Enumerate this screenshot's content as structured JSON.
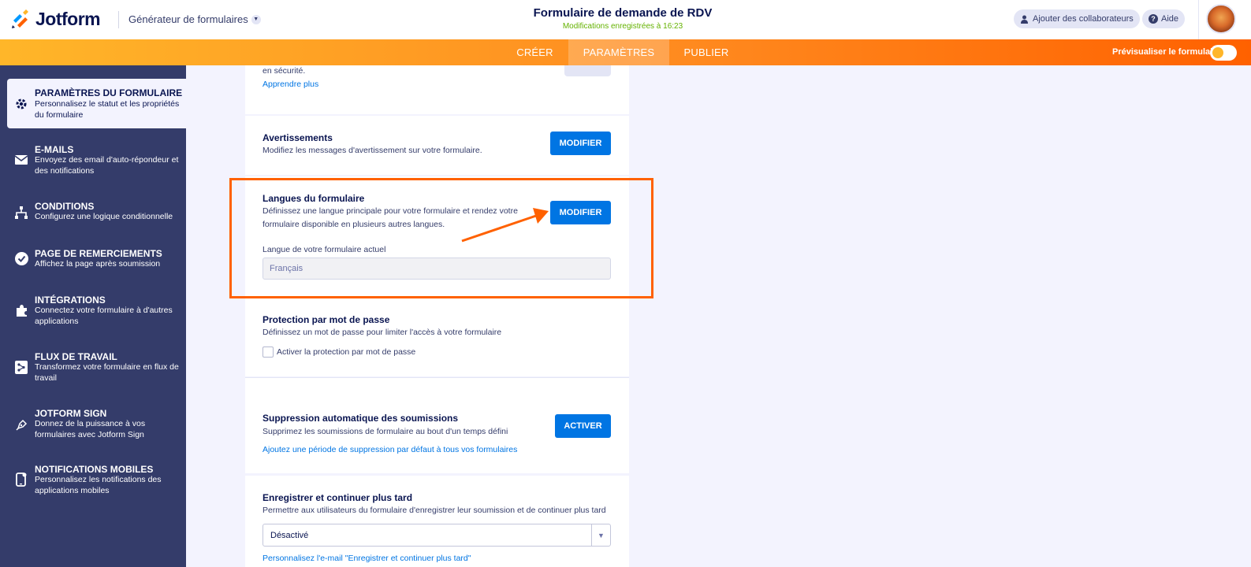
{
  "header": {
    "logo_text": "Jotform",
    "builder_label": "Générateur de formulaires",
    "form_title": "Formulaire de demande de RDV",
    "saved_status": "Modifications enregistrées à 16:23",
    "collab_label": "Ajouter des collaborateurs",
    "help_label": "Aide"
  },
  "nav": {
    "tabs": [
      {
        "label": "CRÉER",
        "active": false
      },
      {
        "label": "PARAMÈTRES",
        "active": true
      },
      {
        "label": "PUBLIER",
        "active": false
      }
    ],
    "preview_label": "Prévisualiser le formulaire"
  },
  "sidebar": {
    "items": [
      {
        "title": "PARAMÈTRES DU FORMULAIRE",
        "desc": "Personnalisez le statut et les propriétés du formulaire",
        "icon": "gear-icon",
        "active": true
      },
      {
        "title": "E-MAILS",
        "desc": "Envoyez des email d'auto-répondeur et des notifications",
        "icon": "envelope-icon"
      },
      {
        "title": "CONDITIONS",
        "desc": "Configurez une logique conditionnelle",
        "icon": "hierarchy-icon"
      },
      {
        "title": "PAGE DE REMERCIEMENTS",
        "desc": "Affichez la page après soumission",
        "icon": "check-circle-icon"
      },
      {
        "title": "INTÉGRATIONS",
        "desc": "Connectez votre formulaire à d'autres applications",
        "icon": "puzzle-icon"
      },
      {
        "title": "FLUX DE TRAVAIL",
        "desc": "Transformez votre formulaire en flux de travail",
        "icon": "workflow-icon"
      },
      {
        "title": "JOTFORM SIGN",
        "desc": "Donnez de la puissance à vos formulaires avec Jotform Sign",
        "icon": "pen-icon"
      },
      {
        "title": "NOTIFICATIONS MOBILES",
        "desc": "Personnalisez les notifications des applications mobiles",
        "icon": "mobile-icon"
      }
    ]
  },
  "content": {
    "top_partial": {
      "desc": "en sécurité.",
      "link": "Apprendre plus"
    },
    "warnings": {
      "title": "Avertissements",
      "desc": "Modifiez les messages d'avertissement sur votre formulaire.",
      "button": "MODIFIER"
    },
    "languages": {
      "title": "Langues du formulaire",
      "desc_line1": "Définissez une langue principale pour votre formulaire et rendez votre",
      "desc_line2": "formulaire disponible en plusieurs autres langues.",
      "button": "MODIFIER",
      "field_label": "Langue de votre formulaire actuel",
      "field_value": "Français"
    },
    "password": {
      "title": "Protection par mot de passe",
      "desc": "Définissez un mot de passe pour limiter l'accès à votre formulaire",
      "checkbox_label": "Activer la protection par mot de passe"
    },
    "auto_delete": {
      "title": "Suppression automatique des soumissions",
      "desc": "Supprimez les soumissions de formulaire au bout d'un temps défini",
      "button": "ACTIVER",
      "link": "Ajoutez une période de suppression par défaut à tous vos formulaires"
    },
    "save_continue": {
      "title": "Enregistrer et continuer plus tard",
      "desc": "Permettre aux utilisateurs du formulaire d'enregistrer leur soumission et de continuer plus tard",
      "select_value": "Désactivé",
      "link": "Personnalisez l'e-mail \"Enregistrer et continuer plus tard\""
    }
  },
  "colors": {
    "accent": "#0075e3",
    "highlight": "#ff6100",
    "sidebar": "#343c6a"
  }
}
